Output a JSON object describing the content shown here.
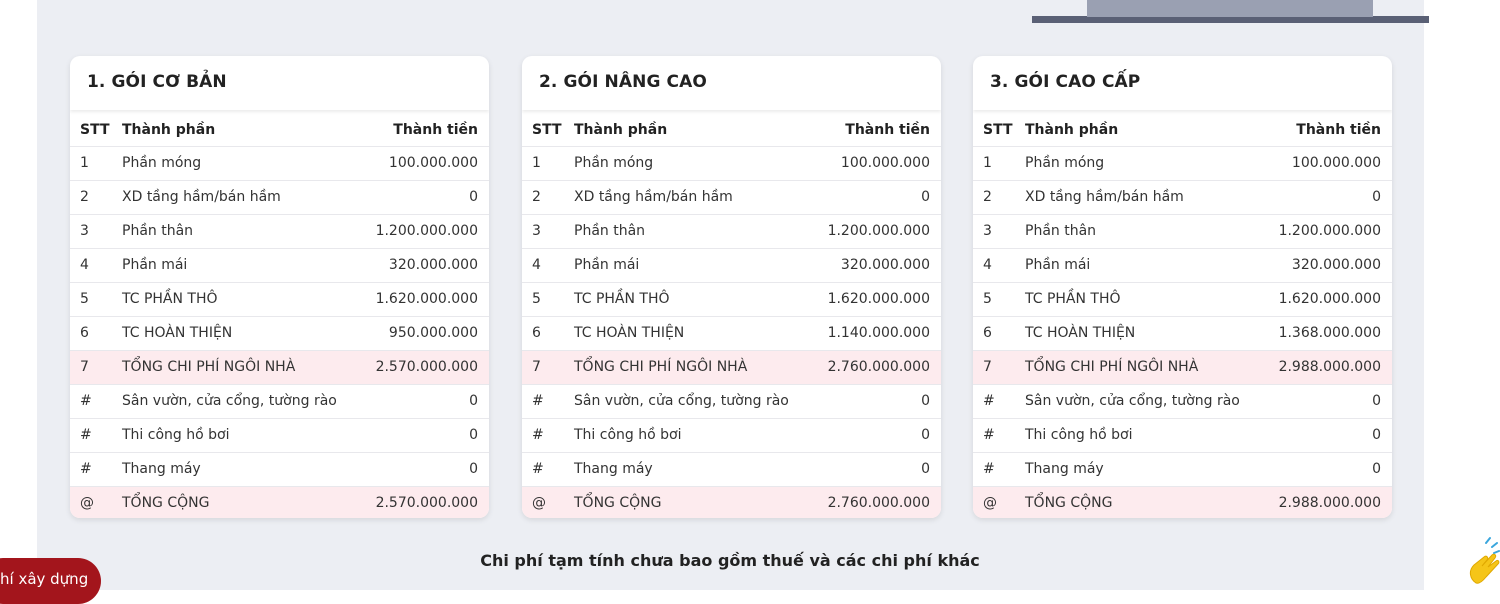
{
  "colors": {
    "panel": "#eceef3",
    "highlight_row": "#fdebee",
    "float_button": "#a3151c"
  },
  "columns": {
    "stt": "STT",
    "name": "Thành phần",
    "amount": "Thành tiền"
  },
  "packages": [
    {
      "title": "1. GÓI CƠ BẢN",
      "rows": [
        {
          "stt": "1",
          "name": "Phần móng",
          "amount": "100.000.000"
        },
        {
          "stt": "2",
          "name": "XD tầng hầm/bán hầm",
          "amount": "0"
        },
        {
          "stt": "3",
          "name": "Phần thân",
          "amount": "1.200.000.000"
        },
        {
          "stt": "4",
          "name": "Phần mái",
          "amount": "320.000.000"
        },
        {
          "stt": "5",
          "name": "TC PHẦN THÔ",
          "amount": "1.620.000.000"
        },
        {
          "stt": "6",
          "name": "TC HOÀN THIỆN",
          "amount": "950.000.000"
        },
        {
          "stt": "7",
          "name": "TỔNG CHI PHÍ NGÔI NHÀ",
          "amount": "2.570.000.000"
        },
        {
          "stt": "#",
          "name": "Sân vườn, cửa cổng, tường rào",
          "amount": "0"
        },
        {
          "stt": "#",
          "name": "Thi công hồ bơi",
          "amount": "0"
        },
        {
          "stt": "#",
          "name": "Thang máy",
          "amount": "0"
        },
        {
          "stt": "@",
          "name": "TỔNG CỘNG",
          "amount": "2.570.000.000"
        }
      ]
    },
    {
      "title": "2. GÓI NÂNG CAO",
      "rows": [
        {
          "stt": "1",
          "name": "Phần móng",
          "amount": "100.000.000"
        },
        {
          "stt": "2",
          "name": "XD tầng hầm/bán hầm",
          "amount": "0"
        },
        {
          "stt": "3",
          "name": "Phần thân",
          "amount": "1.200.000.000"
        },
        {
          "stt": "4",
          "name": "Phần mái",
          "amount": "320.000.000"
        },
        {
          "stt": "5",
          "name": "TC PHẦN THÔ",
          "amount": "1.620.000.000"
        },
        {
          "stt": "6",
          "name": "TC HOÀN THIỆN",
          "amount": "1.140.000.000"
        },
        {
          "stt": "7",
          "name": "TỔNG CHI PHÍ NGÔI NHÀ",
          "amount": "2.760.000.000"
        },
        {
          "stt": "#",
          "name": "Sân vườn, cửa cổng, tường rào",
          "amount": "0"
        },
        {
          "stt": "#",
          "name": "Thi công hồ bơi",
          "amount": "0"
        },
        {
          "stt": "#",
          "name": "Thang máy",
          "amount": "0"
        },
        {
          "stt": "@",
          "name": "TỔNG CỘNG",
          "amount": "2.760.000.000"
        }
      ]
    },
    {
      "title": "3. GÓI CAO CẤP",
      "rows": [
        {
          "stt": "1",
          "name": "Phần móng",
          "amount": "100.000.000"
        },
        {
          "stt": "2",
          "name": "XD tầng hầm/bán hầm",
          "amount": "0"
        },
        {
          "stt": "3",
          "name": "Phần thân",
          "amount": "1.200.000.000"
        },
        {
          "stt": "4",
          "name": "Phần mái",
          "amount": "320.000.000"
        },
        {
          "stt": "5",
          "name": "TC PHẦN THÔ",
          "amount": "1.620.000.000"
        },
        {
          "stt": "6",
          "name": "TC HOÀN THIỆN",
          "amount": "1.368.000.000"
        },
        {
          "stt": "7",
          "name": "TỔNG CHI PHÍ NGÔI NHÀ",
          "amount": "2.988.000.000"
        },
        {
          "stt": "#",
          "name": "Sân vườn, cửa cổng, tường rào",
          "amount": "0"
        },
        {
          "stt": "#",
          "name": "Thi công hồ bơi",
          "amount": "0"
        },
        {
          "stt": "#",
          "name": "Thang máy",
          "amount": "0"
        },
        {
          "stt": "@",
          "name": "TỔNG CỘNG",
          "amount": "2.988.000.000"
        }
      ]
    }
  ],
  "note": "Chi phí tạm tính chưa bao gồm thuế và các chi phí khác",
  "float_button_label": "hí xây dựng",
  "icons": {
    "corner_widget": "hand-wave-icon"
  }
}
